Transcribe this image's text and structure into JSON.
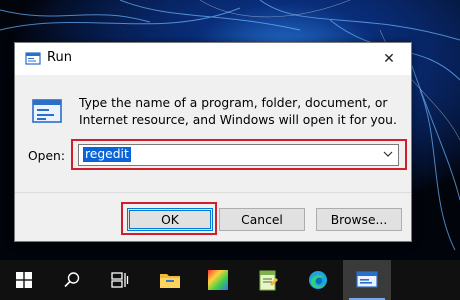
{
  "dialog": {
    "title": "Run",
    "description": "Type the name of a program, folder, document, or Internet resource, and Windows will open it for you.",
    "open_label": "Open:",
    "open_value": "regedit",
    "buttons": {
      "ok": "OK",
      "cancel": "Cancel",
      "browse": "Browse..."
    },
    "close_glyph": "✕"
  },
  "taskbar": {
    "items": [
      "start-icon",
      "search-icon",
      "task-view-icon",
      "file-explorer-icon",
      "color-app-icon",
      "notepad-app-icon",
      "edge-icon",
      "run-app-icon"
    ]
  },
  "colors": {
    "highlight": "#d01f2a",
    "selection": "#0a64d8",
    "taskbar": "#101010"
  }
}
